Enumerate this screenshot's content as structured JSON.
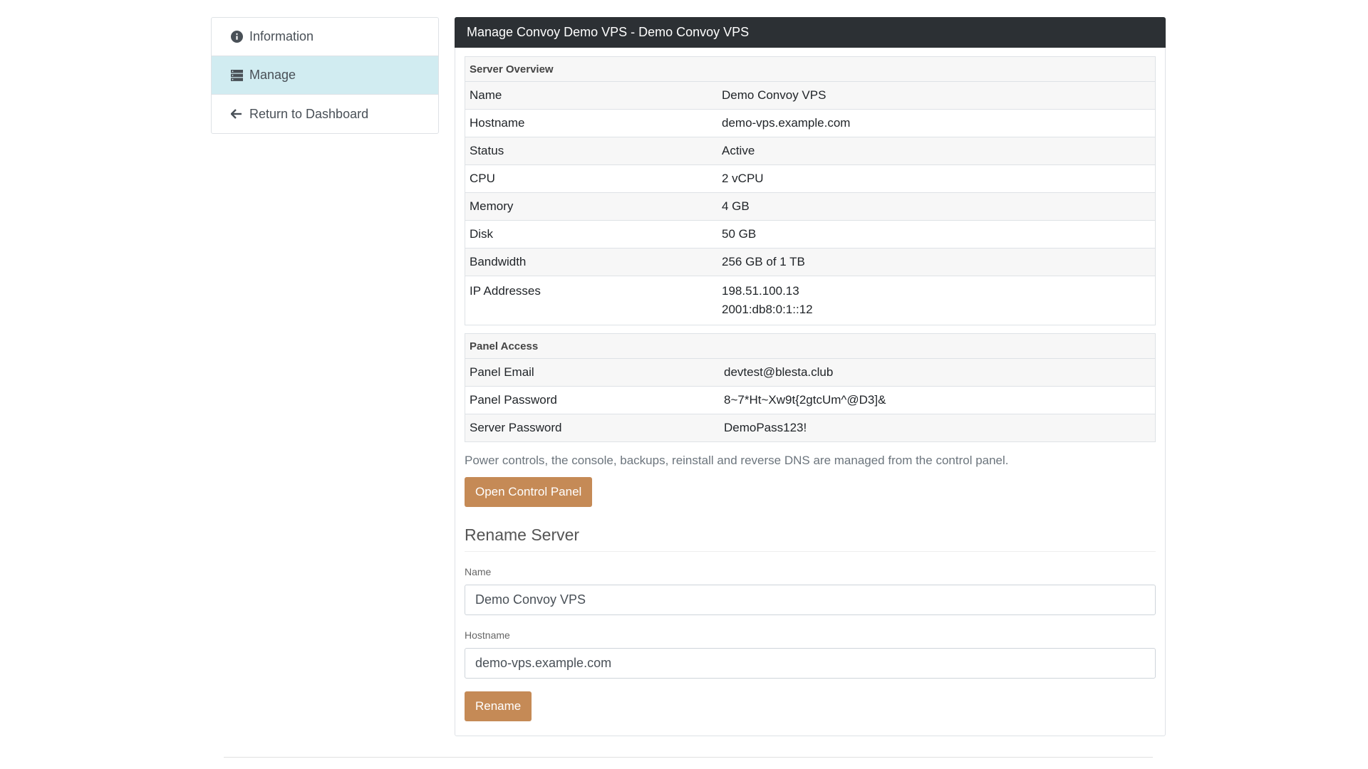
{
  "sidebar": {
    "items": [
      {
        "label": "Information",
        "icon": "info-circle-icon"
      },
      {
        "label": "Manage",
        "icon": "server-icon",
        "active": true
      },
      {
        "label": "Return to Dashboard",
        "icon": "arrow-left-icon"
      }
    ]
  },
  "main": {
    "title": "Manage Convoy Demo VPS - Demo Convoy VPS",
    "overview": {
      "heading": "Server Overview",
      "rows": [
        {
          "label": "Name",
          "value": "Demo Convoy VPS"
        },
        {
          "label": "Hostname",
          "value": "demo-vps.example.com"
        },
        {
          "label": "Status",
          "value": "Active"
        },
        {
          "label": "CPU",
          "value": "2 vCPU"
        },
        {
          "label": "Memory",
          "value": "4 GB"
        },
        {
          "label": "Disk",
          "value": "50 GB"
        },
        {
          "label": "Bandwidth",
          "value": "256 GB of 1 TB"
        }
      ],
      "ip_label": "IP Addresses",
      "ip_values": [
        "198.51.100.13",
        "2001:db8:0:1::12"
      ]
    },
    "panel_access": {
      "heading": "Panel Access",
      "rows": [
        {
          "label": "Panel Email",
          "value": "devtest@blesta.club"
        },
        {
          "label": "Panel Password",
          "value": "8~7*Ht~Xw9t{2gtcUm^@D3]&"
        },
        {
          "label": "Server Password",
          "value": "DemoPass123!"
        }
      ]
    },
    "note": "Power controls, the console, backups, reinstall and reverse DNS are managed from the control panel.",
    "open_panel_label": "Open Control Panel",
    "rename": {
      "heading": "Rename Server",
      "name_label": "Name",
      "name_value": "Demo Convoy VPS",
      "hostname_label": "Hostname",
      "hostname_value": "demo-vps.example.com",
      "button_label": "Rename"
    }
  },
  "colors": {
    "header_bg": "#2c3034",
    "active_item_bg": "#d1ecf1",
    "button_bg": "#c58a56"
  }
}
